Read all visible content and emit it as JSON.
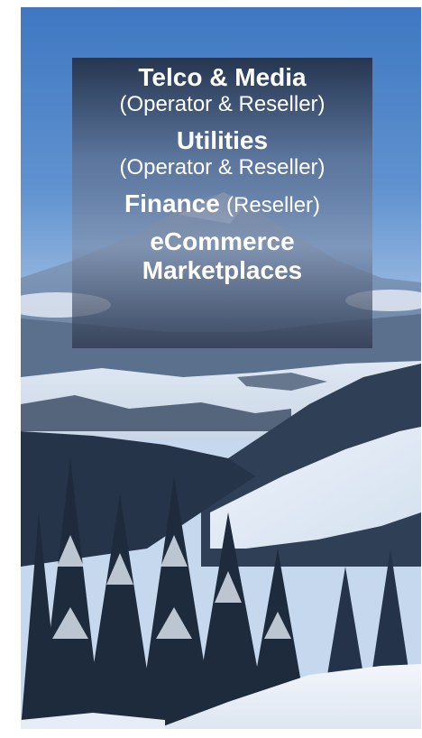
{
  "background": {
    "scene": "snowy alpine mountain landscape with evergreen forest",
    "sky_color": "#4f84c7",
    "snow_color": "#e9eff7"
  },
  "overlay": {
    "sections": [
      {
        "title": "Telco & Media",
        "subtitle": "(Operator & Reseller)"
      },
      {
        "title": "Utilities",
        "subtitle": "(Operator & Reseller)"
      },
      {
        "title": "Finance",
        "subtitle": "(Reseller)"
      },
      {
        "title_line1": "eCommerce",
        "title_line2": "Marketplaces"
      }
    ]
  }
}
